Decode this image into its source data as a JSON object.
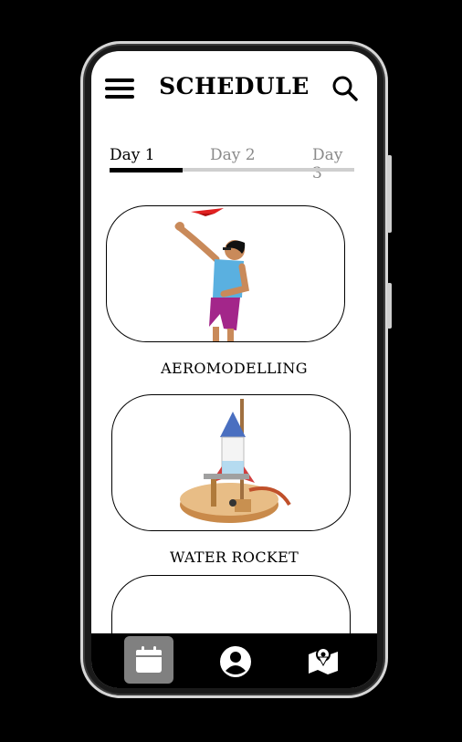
{
  "header": {
    "title": "SCHEDULE"
  },
  "tabs": [
    {
      "label": "Day 1",
      "active": true
    },
    {
      "label": "Day 2",
      "active": false
    },
    {
      "label": "Day 3",
      "active": false
    }
  ],
  "events": [
    {
      "label": "AEROMODELLING",
      "image": "person-throwing-paper-plane"
    },
    {
      "label": "WATER ROCKET",
      "image": "water-rocket-launcher"
    },
    {
      "label": "",
      "image": ""
    }
  ],
  "bottom_nav": [
    {
      "icon": "calendar-icon",
      "active": true
    },
    {
      "icon": "profile-icon",
      "active": false
    },
    {
      "icon": "map-icon",
      "active": false
    }
  ],
  "colors": {
    "active_tab": "#000000",
    "inactive_tab": "#8a8a8a",
    "nav_active_bg": "#808080"
  }
}
